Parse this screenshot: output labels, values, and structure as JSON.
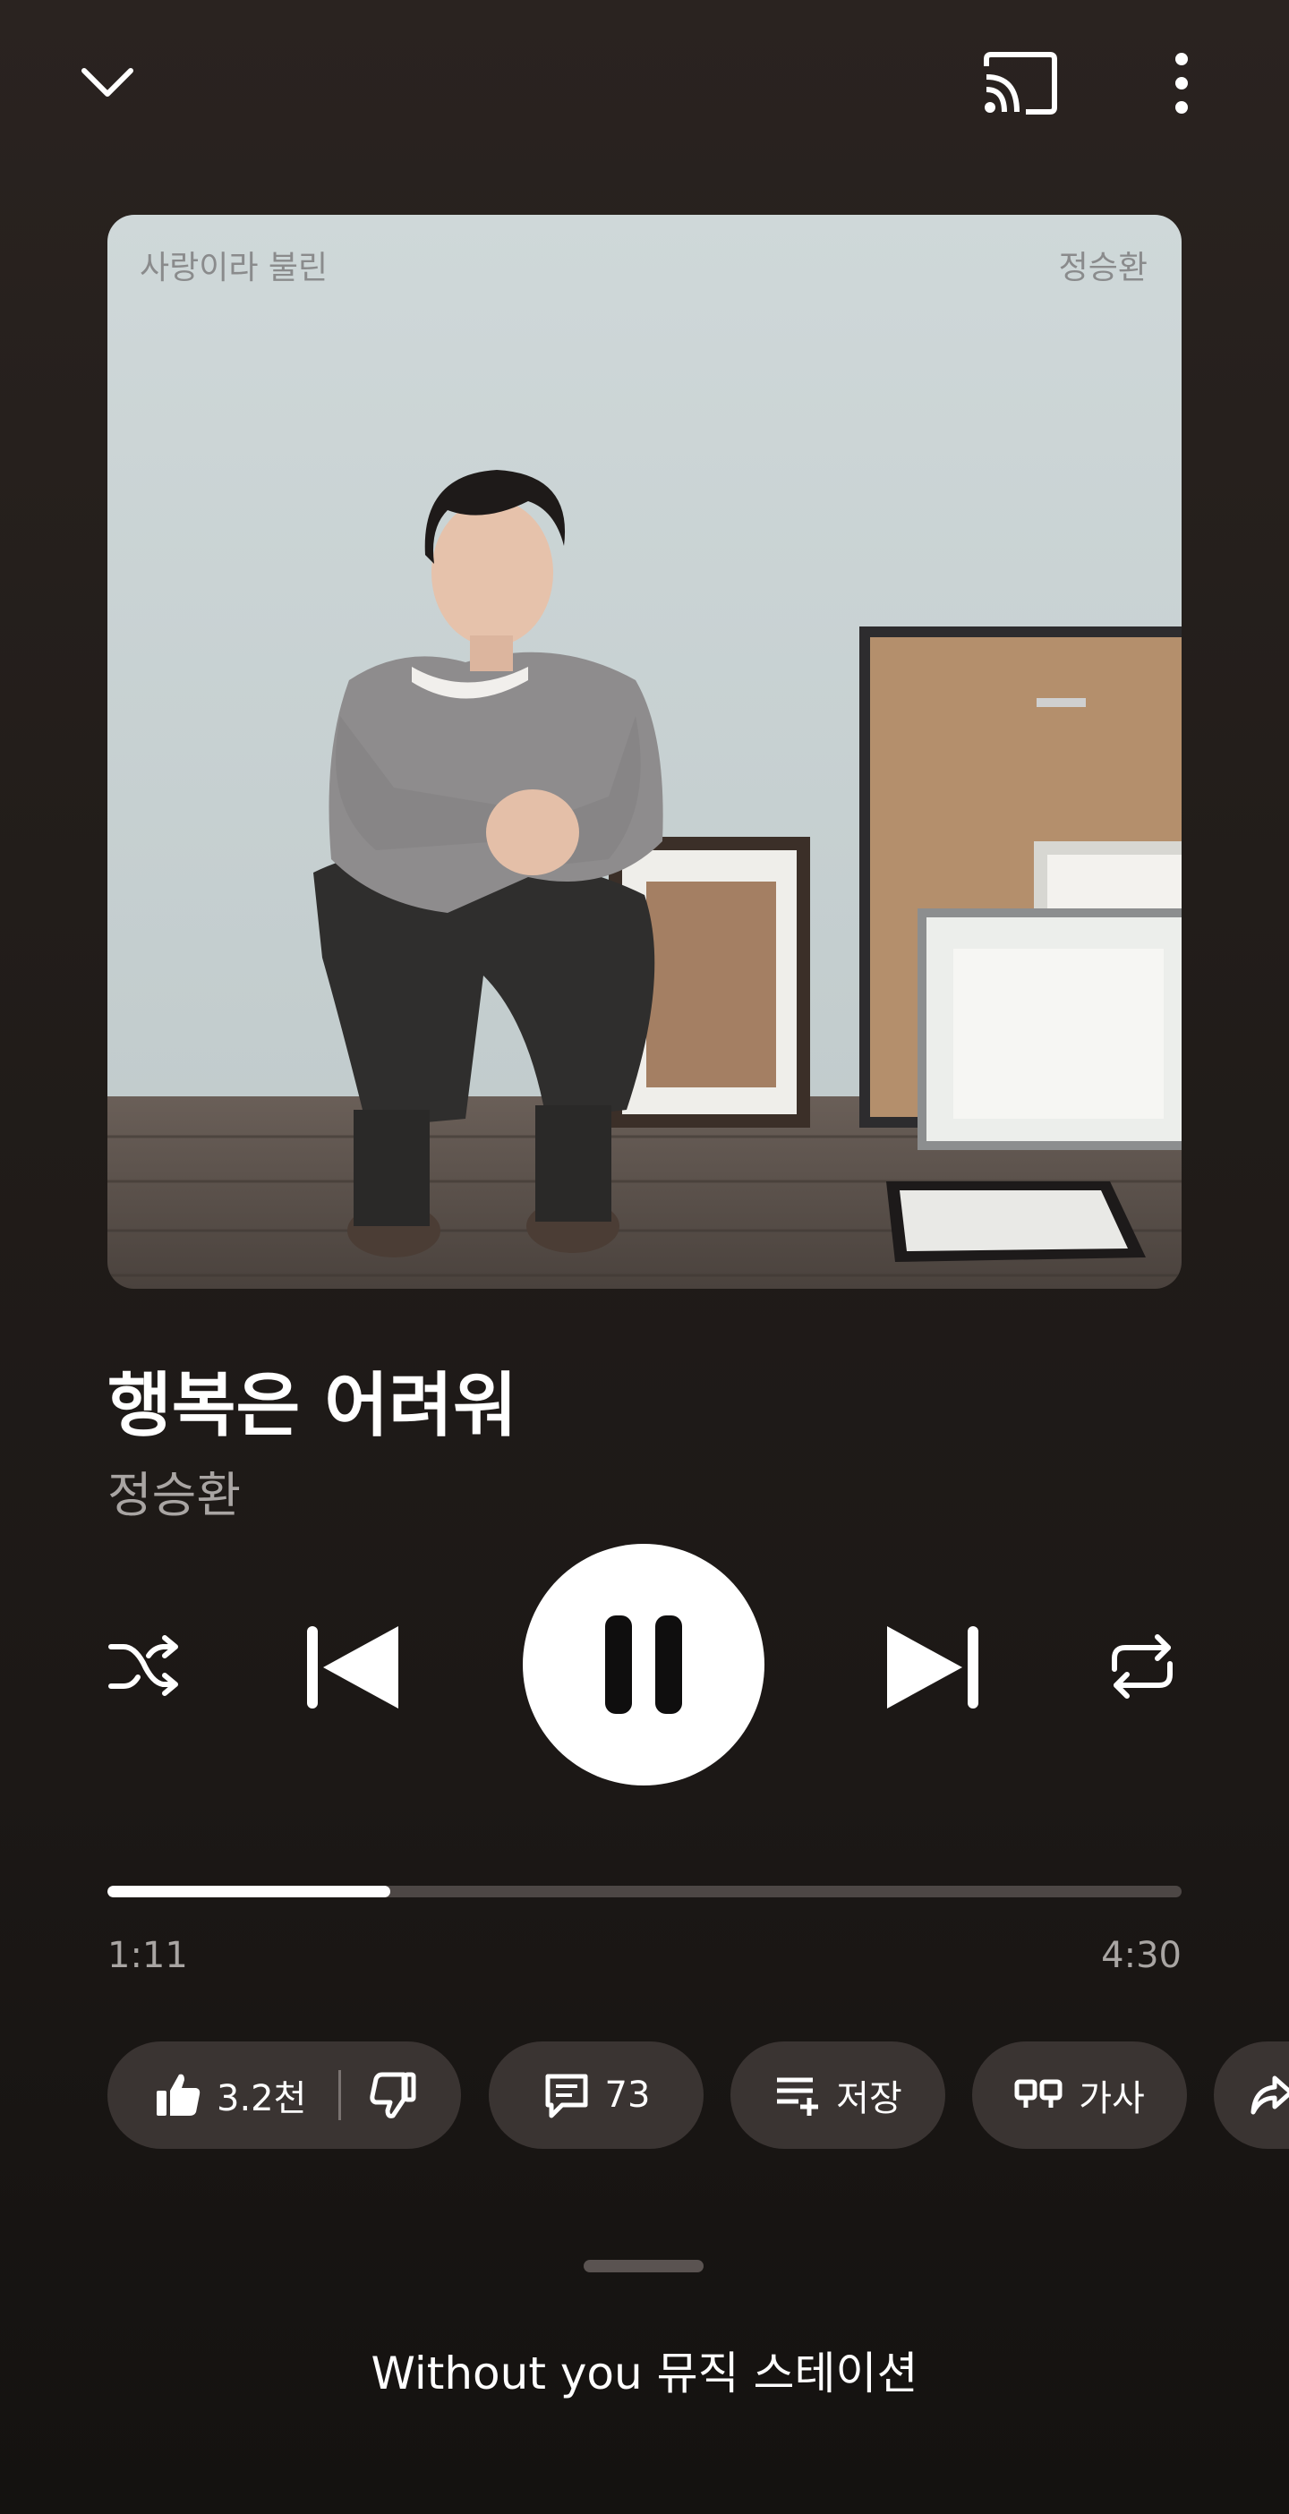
{
  "header": {
    "collapse_icon": "chevron-down-icon",
    "cast_icon": "cast-icon",
    "more_icon": "more-vertical-icon"
  },
  "album": {
    "caption_left": "사랑이라 불린",
    "caption_right": "정승환"
  },
  "song": {
    "title": "행복은 어려워",
    "artist": "정승환"
  },
  "controls": {
    "shuffle_icon": "shuffle-icon",
    "previous_icon": "skip-previous-icon",
    "play_pause_icon": "pause-icon",
    "next_icon": "skip-next-icon",
    "repeat_icon": "repeat-icon"
  },
  "progress": {
    "elapsed": "1:11",
    "total": "4:30",
    "fraction": 0.263
  },
  "actions": {
    "like_count": "3.2천",
    "comment_count": "73",
    "save_label": "저장",
    "lyrics_label": "가사"
  },
  "up_next": {
    "label": "Without you 뮤직 스테이션"
  },
  "colors": {
    "background_top": "#2a2320",
    "background_bottom": "#141210",
    "chip_background": "#3a3432",
    "secondary_text": "#a9a5a3",
    "progress_track": "#4d4745",
    "progress_fill": "#ffffff"
  }
}
